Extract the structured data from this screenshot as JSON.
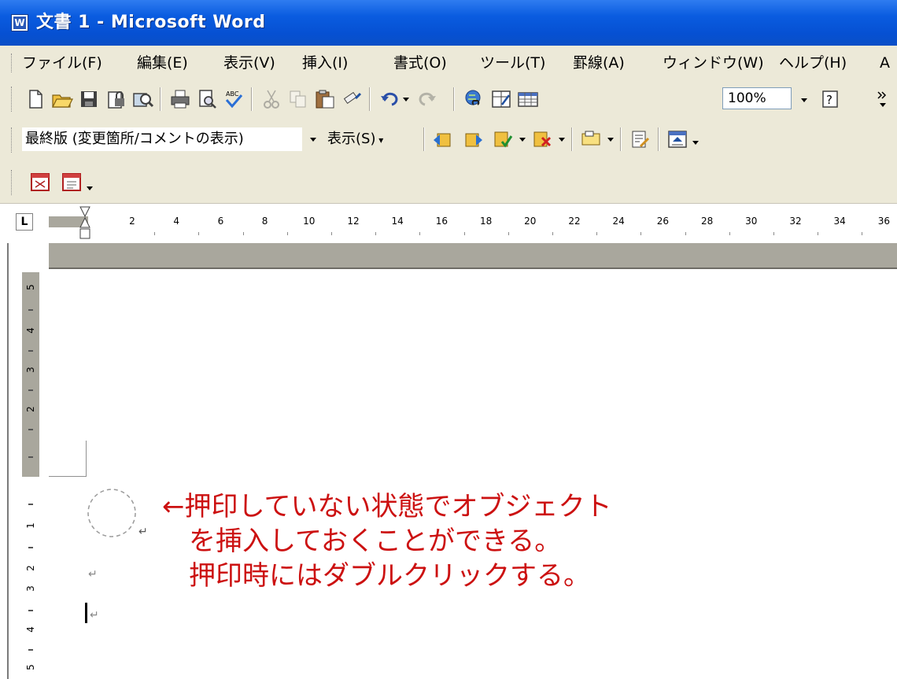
{
  "window": {
    "title": "文書 1 - Microsoft Word",
    "icon": "word-document-icon"
  },
  "menu": {
    "items": [
      "ファイル(F)",
      "編集(E)",
      "表示(V)",
      "挿入(I)",
      "書式(O)",
      "ツール(T)",
      "罫線(A)",
      "ウィンドウ(W)",
      "ヘルプ(H)",
      "A"
    ]
  },
  "toolbar_standard": {
    "icons": [
      "new-document-icon",
      "open-folder-icon",
      "save-icon",
      "permission-icon",
      "research-icon",
      "print-icon",
      "print-preview-icon",
      "spelling-check-icon",
      "cut-icon",
      "copy-icon",
      "paste-icon",
      "format-painter-icon",
      "undo-icon",
      "redo-icon",
      "hyperlink-icon",
      "tables-borders-icon",
      "insert-table-icon",
      "help-icon",
      "toolbar-options-icon"
    ],
    "zoom": "100%"
  },
  "toolbar_reviewing": {
    "display_mode": "最終版 (変更箇所/コメントの表示)",
    "show_menu": "表示(S)",
    "icons": [
      "previous-change-icon",
      "next-change-icon",
      "accept-change-icon",
      "reject-change-icon",
      "new-comment-icon",
      "track-changes-icon",
      "reviewing-pane-icon"
    ]
  },
  "toolbar_stamp": {
    "icons": [
      "stamp-icon",
      "stamp-options-icon"
    ]
  },
  "ruler": {
    "corner": "L",
    "numbers": [
      "2",
      "4",
      "6",
      "8",
      "10",
      "12",
      "14",
      "16",
      "18",
      "20",
      "22",
      "24",
      "26",
      "28",
      "30",
      "32",
      "34",
      "36"
    ],
    "vertical_numbers": [
      "5",
      "4",
      "3",
      "2",
      "1",
      "2",
      "3",
      "4",
      "5"
    ]
  },
  "document": {
    "annotation_lines": [
      "←押印していない状態でオブジェクト",
      "　を挿入しておくことができる。",
      "　押印時にはダブルクリックする。"
    ],
    "annotation_color": "#cc1111",
    "paragraph_mark": "↵"
  },
  "colors": {
    "titlebar": "#0a5ce0",
    "chrome": "#ece9d8",
    "ruler_margin": "#a9a79d"
  }
}
